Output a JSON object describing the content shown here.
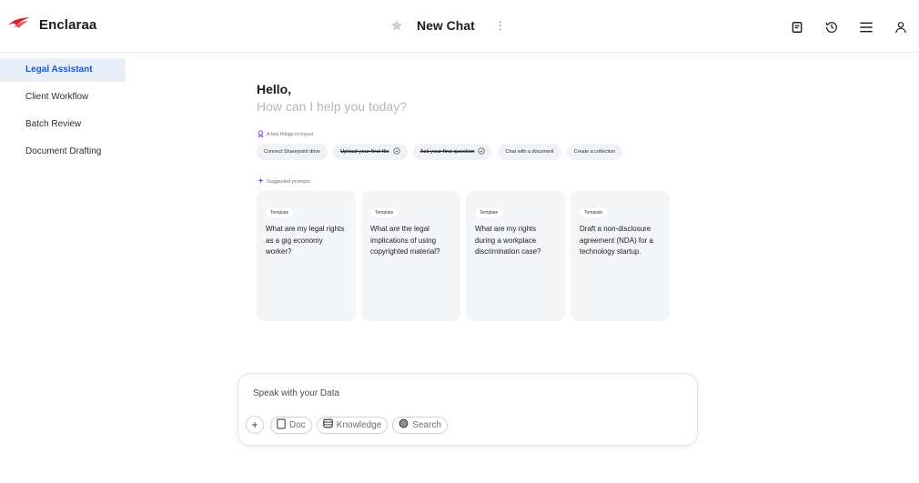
{
  "header": {
    "brand": "Enclaraa",
    "chat_title": "New Chat",
    "kebab": "⋮",
    "icons": [
      "notes-icon",
      "history-icon",
      "menu-icon",
      "user-icon"
    ]
  },
  "sidebar": {
    "items": [
      {
        "label": "Legal Assistant",
        "active": true
      },
      {
        "label": "Client Workflow",
        "active": false
      },
      {
        "label": "Batch Review",
        "active": false
      },
      {
        "label": "Document Drafting",
        "active": false
      }
    ]
  },
  "greeting": {
    "hello": "Hello,",
    "subtitle": "How can I help you today?"
  },
  "tips": {
    "label": "A few things to tryout",
    "chips": [
      {
        "label": "Connect Sharepoint drive",
        "done": false
      },
      {
        "label": "Upload your first file",
        "done": true
      },
      {
        "label": "Ask your first question",
        "done": true
      },
      {
        "label": "Chat with a document",
        "done": false
      },
      {
        "label": "Create a collection",
        "done": false
      }
    ]
  },
  "prompts": {
    "label": "Suggested prompts",
    "cards": [
      {
        "tag": "Template",
        "text": "What are my legal rights as a gig economy worker?"
      },
      {
        "tag": "Template",
        "text": "What are the legal implications of using copyrighted material?"
      },
      {
        "tag": "Template",
        "text": "What are my rights during a workplace discrimination case?"
      },
      {
        "tag": "Template",
        "text": "Draft a non-disclosure agreement (NDA) for a technology startup."
      }
    ]
  },
  "composer": {
    "placeholder": "Speak with your Data",
    "plus": "+",
    "tools": {
      "doc": "Doc",
      "knowledge": "Knowledge",
      "search": "Search"
    }
  },
  "colors": {
    "accent": "#1f57c3",
    "logo": "#d8232a",
    "active_bg": "#e8eefa"
  }
}
